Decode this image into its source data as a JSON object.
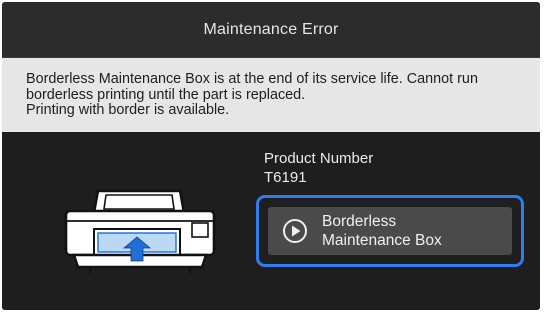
{
  "dialog": {
    "title": "Maintenance Error"
  },
  "message": {
    "lines": [
      "Borderless Maintenance Box is at the end of its service life. Cannot run",
      "borderless printing until the part is replaced.",
      "Printing with border is available."
    ]
  },
  "product": {
    "number_label": "Product Number",
    "number_value": "T6191"
  },
  "part_button": {
    "label_line1": "Borderless",
    "label_line2": "Maintenance Box",
    "icon": "play-circle-icon",
    "highlight_color": "#2f7df0"
  },
  "illustration": {
    "icon": "printer-icon",
    "arrow": "arrow-up-icon",
    "arrow_color": "#1f6fd6"
  }
}
